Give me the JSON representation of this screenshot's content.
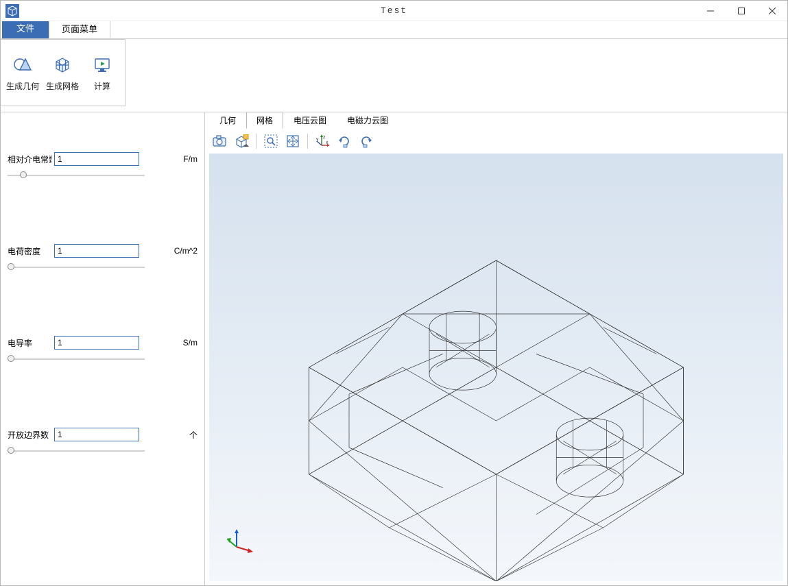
{
  "window": {
    "title": "Test"
  },
  "ribbon": {
    "file_tab": "文件",
    "page_menu_tab": "页面菜单",
    "buttons": {
      "geometry": "生成几何",
      "mesh": "生成网格",
      "compute": "计算"
    }
  },
  "params": {
    "rel_permittivity": {
      "label": "相对介电常数",
      "value": "1",
      "unit": "F/m"
    },
    "charge_density": {
      "label": "电荷密度",
      "value": "1",
      "unit": "C/m^2"
    },
    "conductivity": {
      "label": "电导率",
      "value": "1",
      "unit": "S/m"
    },
    "open_boundary": {
      "label": "开放边界数",
      "value": "1",
      "unit": "个"
    }
  },
  "view_tabs": {
    "geometry": "几何",
    "mesh": "网格",
    "voltage": "电压云图",
    "force": "电磁力云图"
  },
  "toolbar_icons": {
    "snapshot": "camera-icon",
    "view3d": "cube-view-icon",
    "zoom_window": "zoom-window-icon",
    "zoom_extents": "zoom-extents-icon",
    "axes": "axes-icon",
    "rotate_cw": "rotate-cw-icon",
    "rotate_ccw": "rotate-ccw-icon"
  }
}
